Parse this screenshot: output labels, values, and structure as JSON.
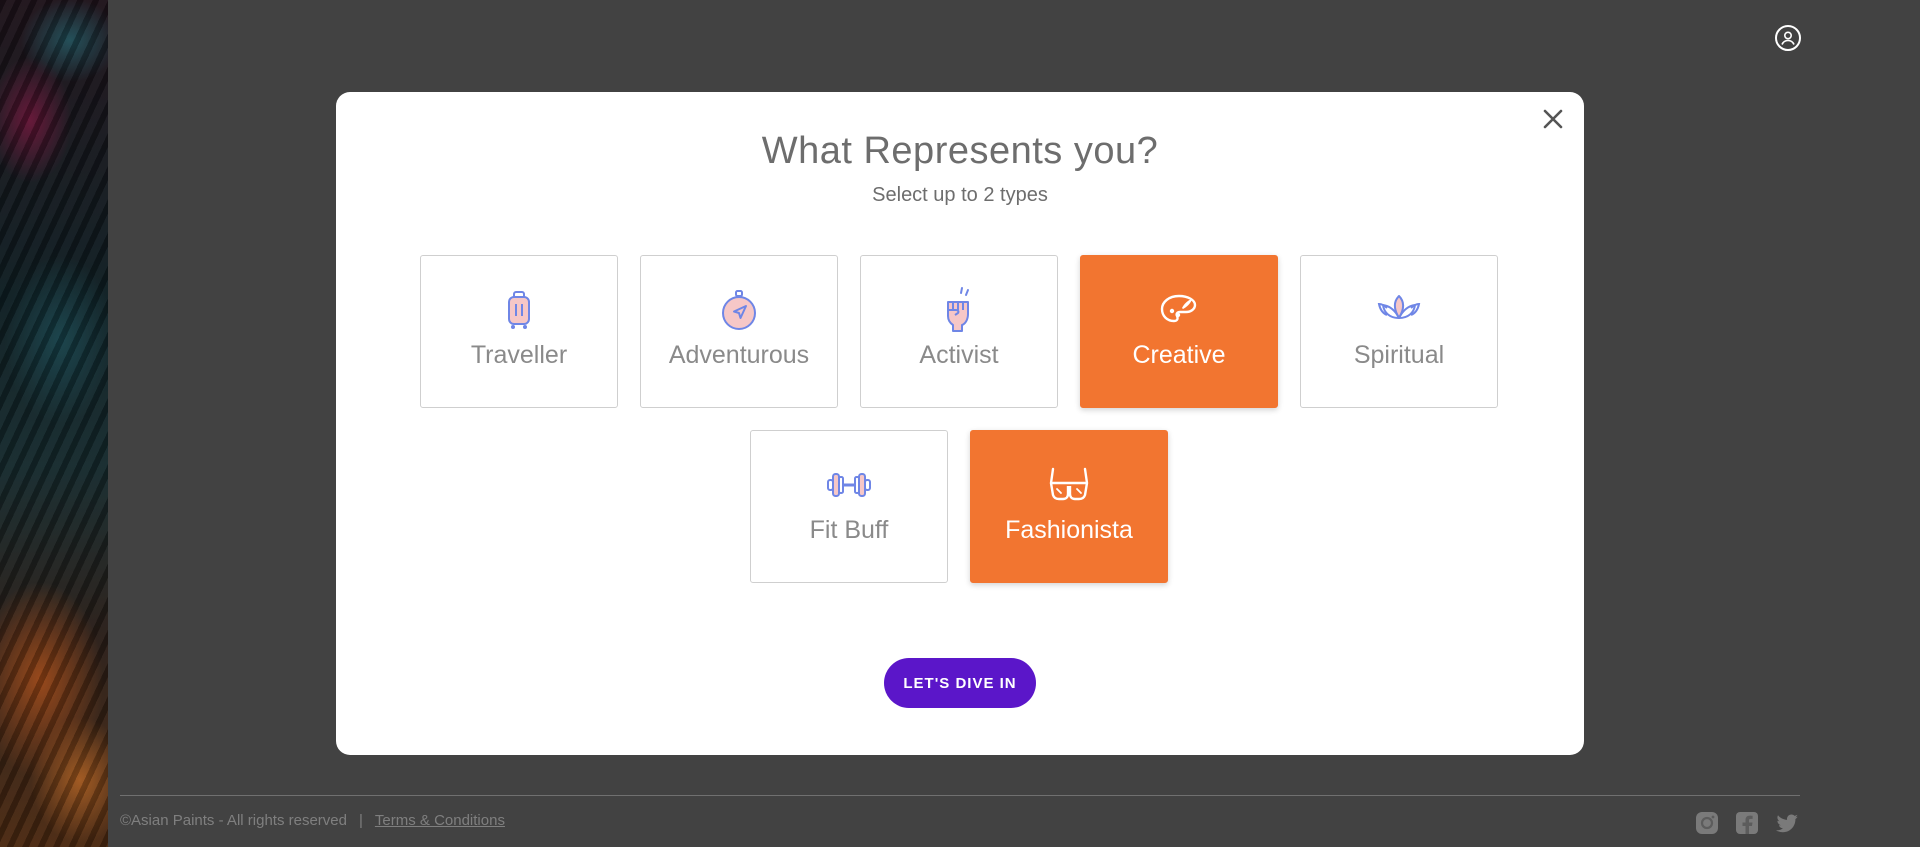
{
  "header": {
    "profile_icon": "user-circle-icon"
  },
  "modal": {
    "title": "What Represents you?",
    "subtitle": "Select up to 2 types",
    "close_icon": "close-icon",
    "options": [
      {
        "label": "Traveller",
        "icon": "suitcase-icon",
        "selected": false
      },
      {
        "label": "Adventurous",
        "icon": "compass-icon",
        "selected": false
      },
      {
        "label": "Activist",
        "icon": "raised-fist-icon",
        "selected": false
      },
      {
        "label": "Creative",
        "icon": "palette-icon",
        "selected": true
      },
      {
        "label": "Spiritual",
        "icon": "lotus-icon",
        "selected": false
      },
      {
        "label": "Fit Buff",
        "icon": "dumbbell-icon",
        "selected": false
      },
      {
        "label": "Fashionista",
        "icon": "sunglasses-icon",
        "selected": true
      }
    ],
    "cta_label": "LET'S DIVE IN"
  },
  "footer": {
    "copyright": "©Asian Paints - All rights reserved",
    "separator": "|",
    "terms_label": "Terms & Conditions",
    "social_icons": [
      "instagram-icon",
      "facebook-icon",
      "twitter-icon"
    ]
  },
  "colors": {
    "accent_orange": "#f27530",
    "cta_purple": "#5b16c9",
    "icon_blue": "#6f86e6",
    "icon_pink": "#f6c7c7"
  }
}
